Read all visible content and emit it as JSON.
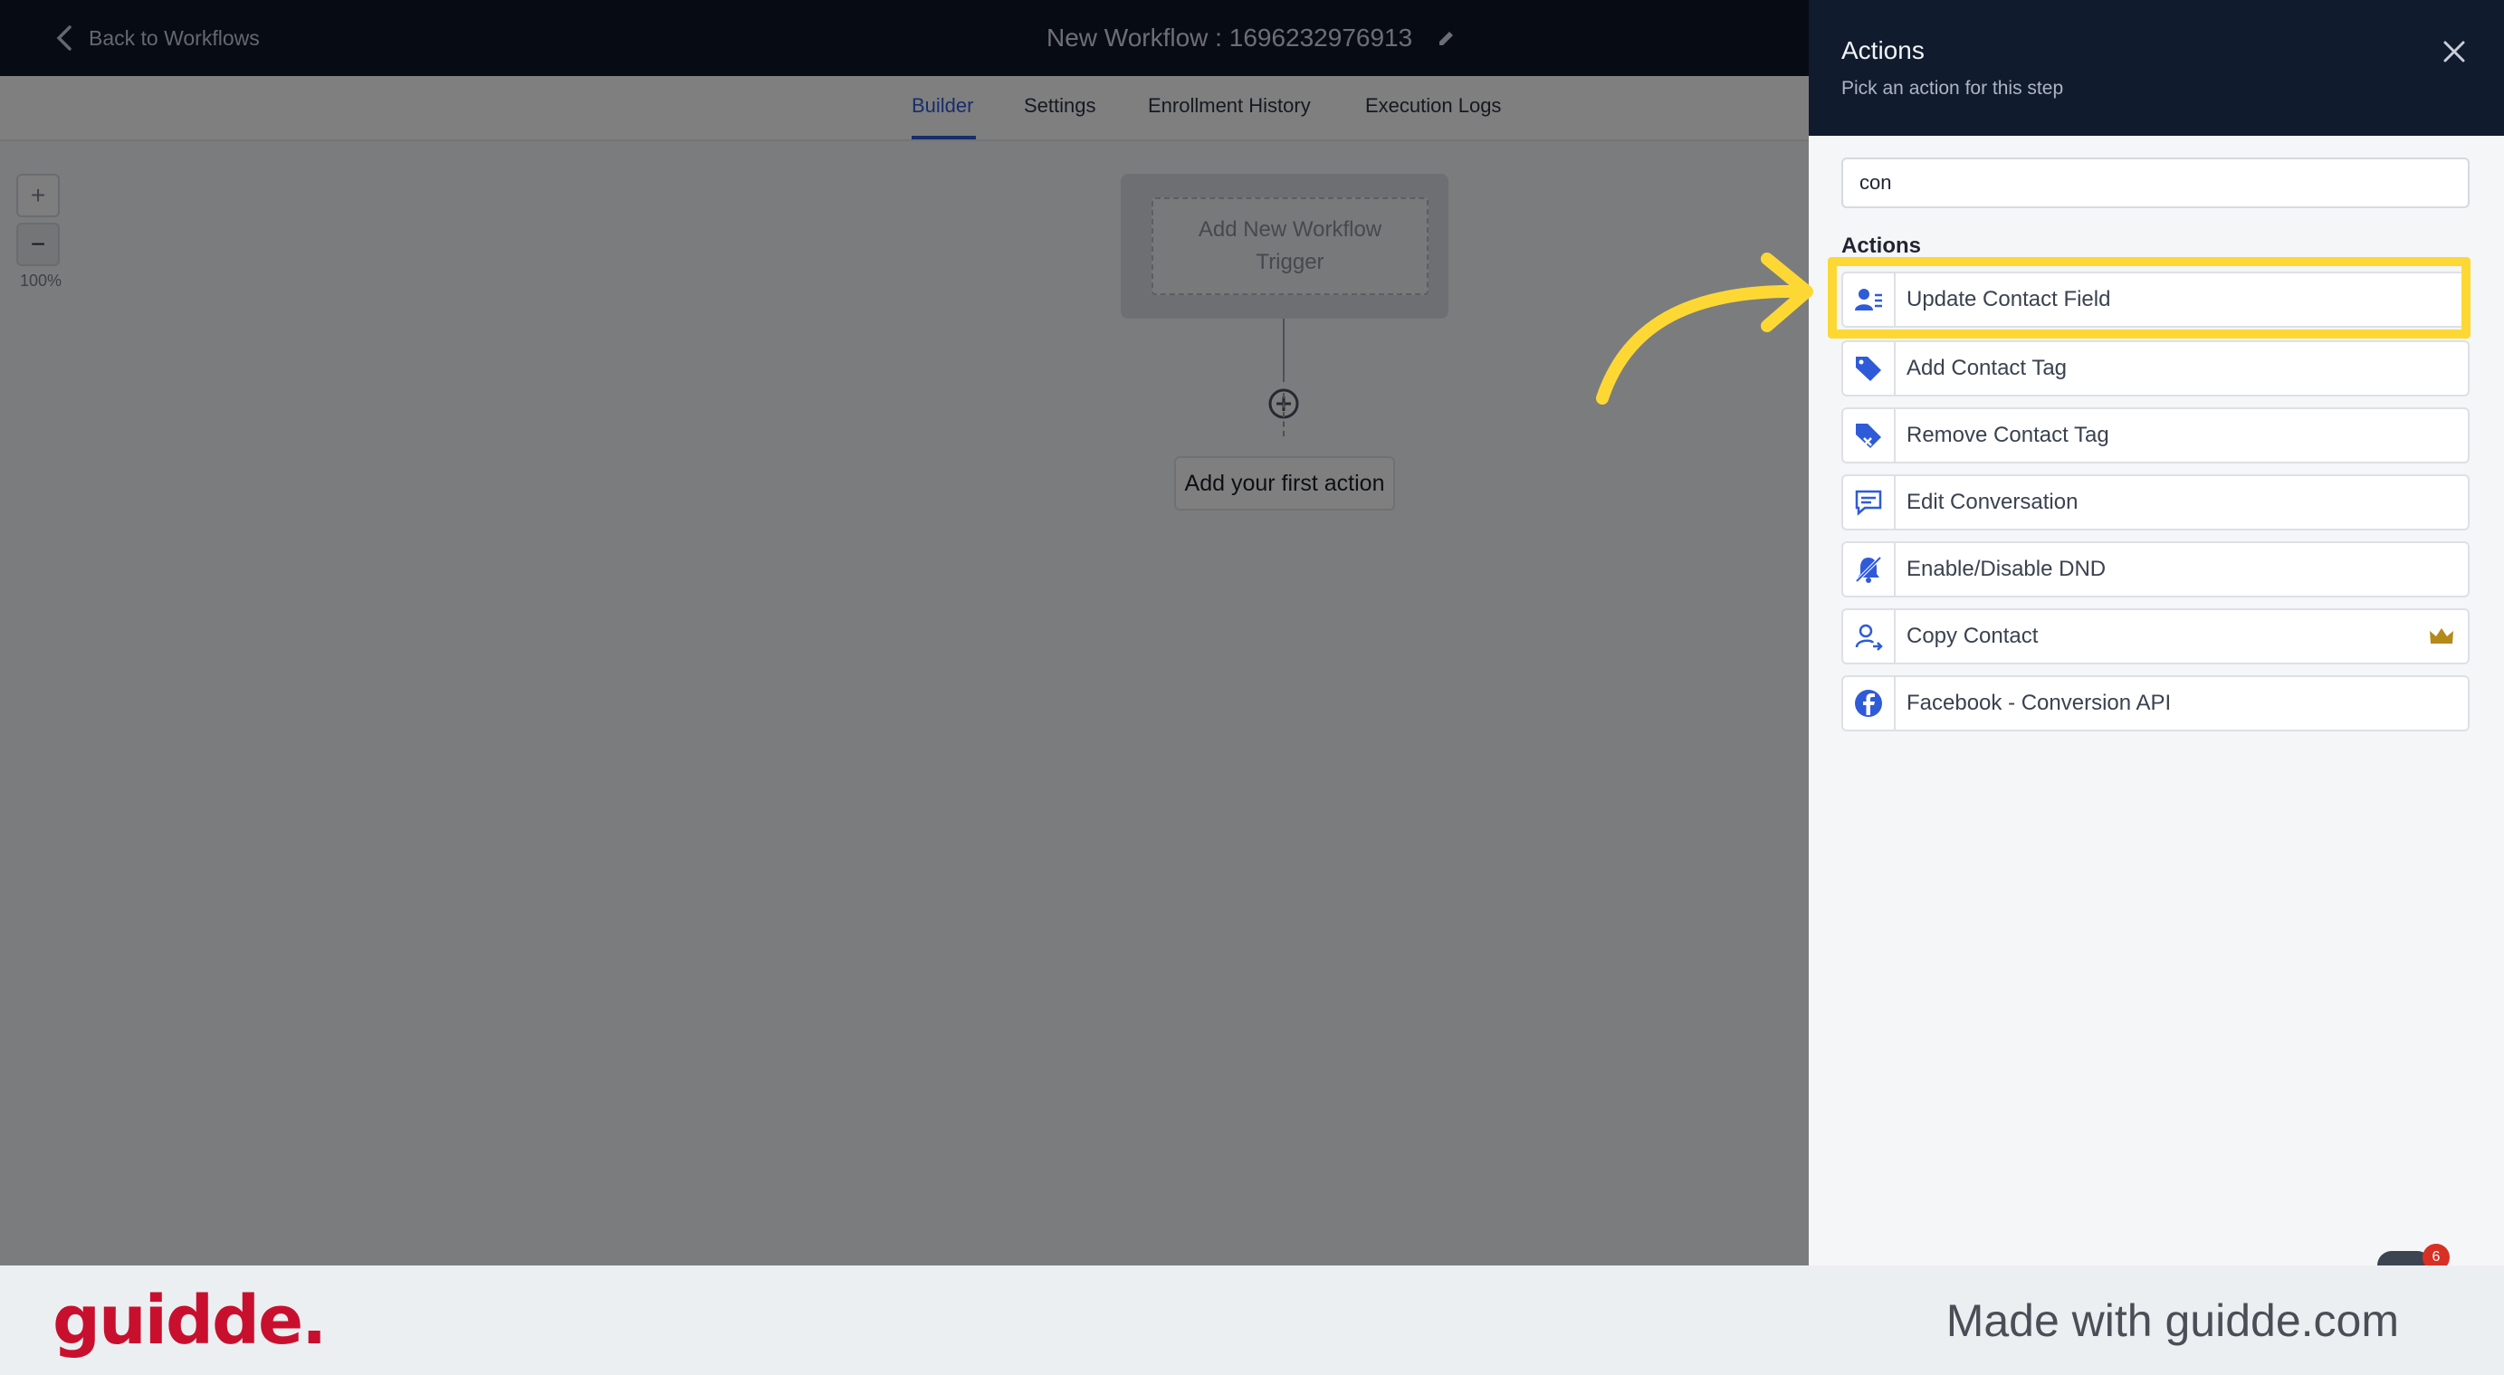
{
  "header": {
    "back_label": "Back to Workflows",
    "workflow_title": "New Workflow : 1696232976913"
  },
  "tabs": [
    {
      "label": "Builder",
      "active": true
    },
    {
      "label": "Settings",
      "active": false
    },
    {
      "label": "Enrollment History",
      "active": false
    },
    {
      "label": "Execution Logs",
      "active": false
    }
  ],
  "canvas": {
    "zoom_in_label": "+",
    "zoom_out_label": "−",
    "zoom_level": "100%",
    "trigger_placeholder": "Add New Workflow Trigger",
    "first_action_label": "Add your first action"
  },
  "drawer": {
    "title": "Actions",
    "subtitle": "Pick an action for this step",
    "search_value": "con",
    "section_label": "Actions",
    "items": [
      {
        "label": "Update Contact Field",
        "icon": "contact-field-icon",
        "highlighted": true
      },
      {
        "label": "Add Contact Tag",
        "icon": "tag-icon"
      },
      {
        "label": "Remove Contact Tag",
        "icon": "tag-remove-icon"
      },
      {
        "label": "Edit Conversation",
        "icon": "conversation-icon"
      },
      {
        "label": "Enable/Disable DND",
        "icon": "bell-off-icon"
      },
      {
        "label": "Copy Contact",
        "icon": "user-copy-icon",
        "premium": true
      },
      {
        "label": "Facebook - Conversion API",
        "icon": "facebook-icon"
      }
    ],
    "help_badge_count": "6"
  },
  "footer": {
    "logo": "guidde.",
    "tagline": "Made with guidde.com"
  },
  "colors": {
    "accent": "#2f5bd8",
    "highlight": "#fdd835",
    "header_bg": "#0f1729",
    "icon_blue": "#2f5bd8",
    "brand": "#c8102e"
  }
}
